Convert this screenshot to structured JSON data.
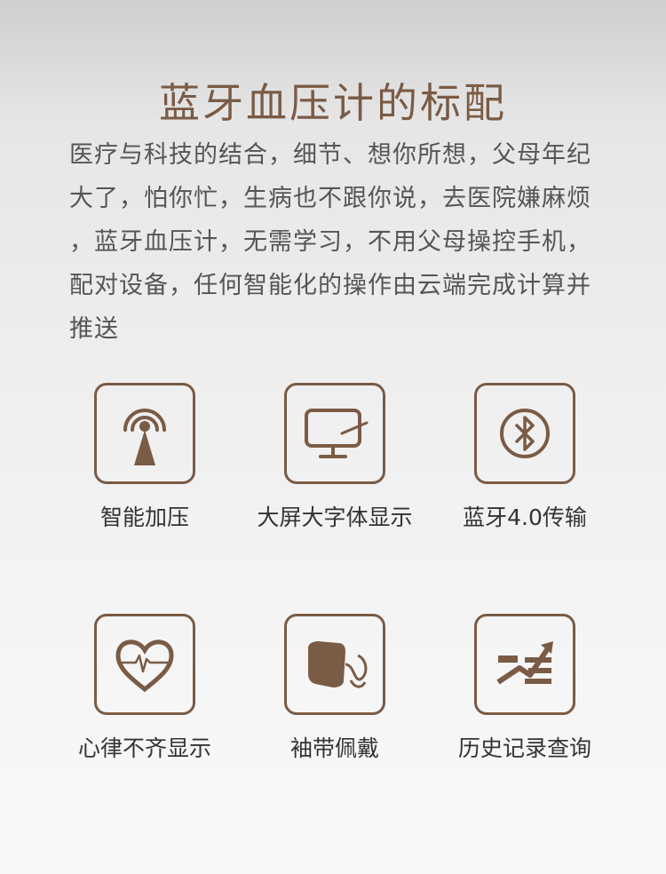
{
  "title": "蓝牙血压计的标配",
  "description_lines": [
    "医疗与科技的结合，细节、想你所想，父母年纪",
    "大了，怕你忙，生病也不跟你说，去医院嫌麻烦",
    "，蓝牙血压计，无需学习，不用父母操控手机，",
    "配对设备，任何智能化的操作由云端完成计算并",
    "推送"
  ],
  "features": [
    {
      "label": "智能加压",
      "icon": "signal-tower-icon"
    },
    {
      "label": "大屏大字体显示",
      "icon": "monitor-icon"
    },
    {
      "label": "蓝牙4.0传输",
      "icon": "bluetooth-icon"
    },
    {
      "label": "心律不齐显示",
      "icon": "heartbeat-icon"
    },
    {
      "label": "袖带佩戴",
      "icon": "cuff-icon"
    },
    {
      "label": "历史记录查询",
      "icon": "history-chart-icon"
    }
  ],
  "colors": {
    "accent": "#7a5b45",
    "text": "#555555",
    "label": "#333333"
  }
}
